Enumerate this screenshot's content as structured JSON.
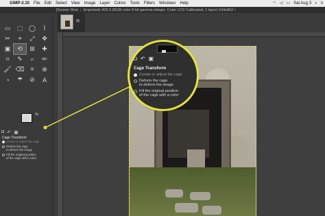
{
  "menubar": {
    "app_name": "GIMP-2.10",
    "items": [
      "File",
      "Edit",
      "Select",
      "View",
      "Image",
      "Layer",
      "Colors",
      "Tools",
      "Filters",
      "Windows",
      "Help"
    ],
    "datetime": "Sat Aug 3",
    "icons": [
      "apple-icon",
      "wifi-icon",
      "volume-icon",
      "battery-icon",
      "search-icon",
      "menu-icon"
    ]
  },
  "tabbar": {
    "tab_label": "[Screen Shot",
    "title": "(imported)-429.0 (RGB color 8-bit gamma integer, Color LCD Calibrated, 1 layer) 634x862 •"
  },
  "toolbox": {
    "tools": [
      "▭",
      "⬚",
      "◯",
      "⌇",
      "✂",
      "⌖",
      "⤢",
      "✥",
      "▣",
      "⟲",
      "⊞",
      "✚",
      "⌗",
      "✎",
      "⌕",
      "✏",
      "🖌",
      "⌫",
      "⍟",
      "⊕",
      "◔",
      "☂",
      "⊘",
      "A"
    ],
    "active_tool_index": 9
  },
  "tool_options": {
    "tab_icons": [
      "◘",
      "↶",
      "▣"
    ],
    "title": "Cage Transform",
    "options": [
      {
        "label": "Create or adjust the cage",
        "selected": true
      },
      {
        "label": "Deform the cage\nto deform the image",
        "selected": false
      },
      {
        "label": "Fill the original position\nof the cage with a color",
        "selected": false
      }
    ]
  },
  "zoom": {
    "tab_icons": [
      "◘",
      "↶",
      "▣"
    ],
    "title": "Cage Transform",
    "options": [
      {
        "line1": "Create or adjust the cage",
        "line2": ""
      },
      {
        "line1": "Deform the cage",
        "line2": "to deform the image"
      },
      {
        "line1": "Fill the original position",
        "line2": "of the cage with a color"
      }
    ]
  },
  "colors": {
    "accent": "#e3e33a"
  }
}
